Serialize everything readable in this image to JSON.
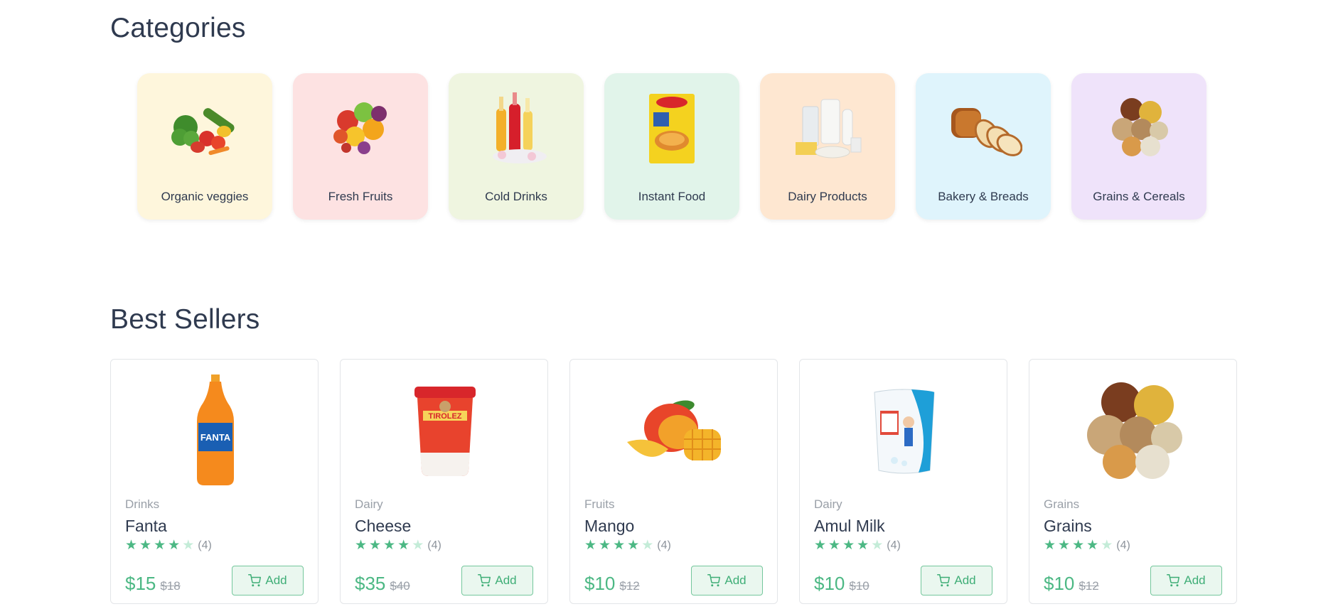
{
  "categories": {
    "title": "Categories",
    "items": [
      {
        "label": "Organic veggies",
        "bg": "#fef6dc",
        "icon": "vegetables-icon"
      },
      {
        "label": "Fresh Fruits",
        "bg": "#fde2e2",
        "icon": "fruits-icon"
      },
      {
        "label": "Cold Drinks",
        "bg": "#eff5e0",
        "icon": "drinks-icon"
      },
      {
        "label": "Instant Food",
        "bg": "#e1f4ea",
        "icon": "noodles-icon"
      },
      {
        "label": "Dairy Products",
        "bg": "#fee7d1",
        "icon": "dairy-icon"
      },
      {
        "label": "Bakery & Breads",
        "bg": "#dff4fc",
        "icon": "bread-icon"
      },
      {
        "label": "Grains & Cereals",
        "bg": "#efe3fa",
        "icon": "grains-icon"
      }
    ]
  },
  "best_sellers": {
    "title": "Best Sellers",
    "products": [
      {
        "category": "Drinks",
        "name": "Fanta",
        "rating": 4,
        "rating_count": "(4)",
        "price": "$15",
        "old_price": "$18",
        "add_label": "Add",
        "image": "fanta-bottle-image"
      },
      {
        "category": "Dairy",
        "name": "Cheese",
        "rating": 4,
        "rating_count": "(4)",
        "price": "$35",
        "old_price": "$40",
        "add_label": "Add",
        "image": "cheese-tub-image"
      },
      {
        "category": "Fruits",
        "name": "Mango",
        "rating": 4,
        "rating_count": "(4)",
        "price": "$10",
        "old_price": "$12",
        "add_label": "Add",
        "image": "mango-image"
      },
      {
        "category": "Dairy",
        "name": "Amul Milk",
        "rating": 4,
        "rating_count": "(4)",
        "price": "$10",
        "old_price": "$10",
        "add_label": "Add",
        "image": "milk-pouch-image"
      },
      {
        "category": "Grains",
        "name": "Grains",
        "rating": 4,
        "rating_count": "(4)",
        "price": "$10",
        "old_price": "$12",
        "add_label": "Add",
        "image": "grains-image"
      }
    ]
  },
  "colors": {
    "accent": "#4cb884",
    "heading": "#2f3a4f"
  }
}
